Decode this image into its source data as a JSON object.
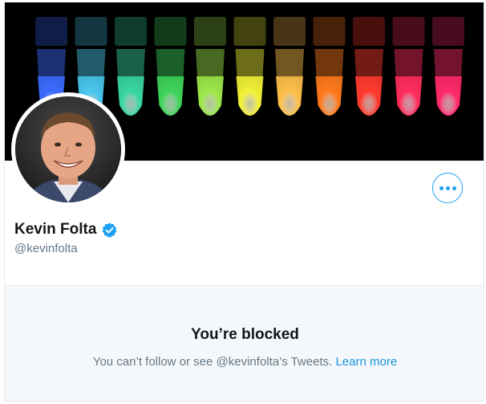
{
  "profile": {
    "display_name": "Kevin Folta",
    "handle": "@kevinfolta",
    "verified_icon": "verified-badge-icon",
    "more_icon": "more-options-icon"
  },
  "banner": {
    "description_icon": "fluorescent-tubes-banner",
    "tube_colors": [
      "#3b6cff",
      "#49c7ee",
      "#39d6a4",
      "#3fd45a",
      "#9ee84a",
      "#f2f238",
      "#ffc04a",
      "#ff7a1c",
      "#ff3b2e",
      "#ff2d5e",
      "#ff2a6a"
    ]
  },
  "blocked": {
    "title": "You’re blocked",
    "description": "You can’t follow or see @kevinfolta’s Tweets.",
    "learn_more": "Learn more"
  },
  "colors": {
    "accent": "#1da1f2",
    "link": "#1b95e0",
    "muted": "#657786",
    "panel_bg": "#f5f8fa"
  }
}
